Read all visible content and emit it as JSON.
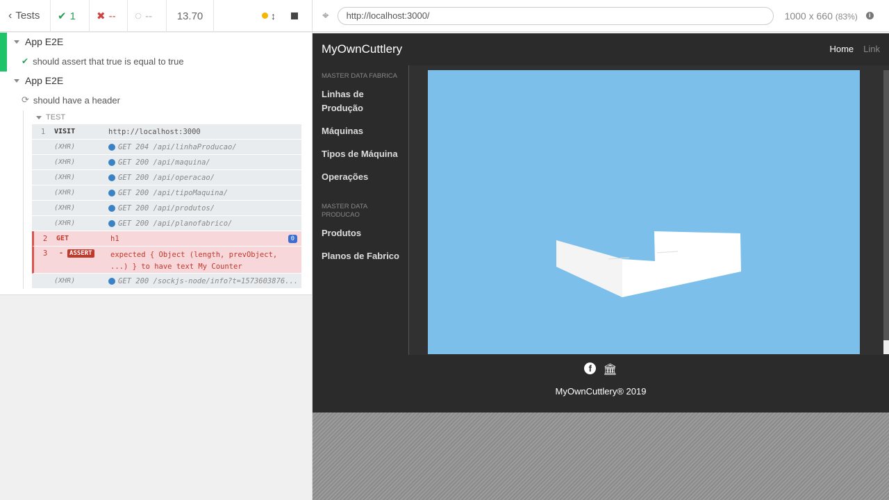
{
  "reporter": {
    "back_label": "Tests",
    "passed": "1",
    "failed": "--",
    "pending": "--",
    "duration": "13.70",
    "suites": [
      {
        "title": "App E2E",
        "test": "should assert that true is equal to true"
      },
      {
        "title": "App E2E",
        "test": "should have a header",
        "test_label": "TEST",
        "commands": [
          {
            "num": "1",
            "name": "VISIT",
            "msg": "http://localhost:3000"
          },
          {
            "num": "",
            "name": "(XHR)",
            "msg": "GET 204 /api/linhaProducao/"
          },
          {
            "num": "",
            "name": "(XHR)",
            "msg": "GET 200 /api/maquina/"
          },
          {
            "num": "",
            "name": "(XHR)",
            "msg": "GET 200 /api/operacao/"
          },
          {
            "num": "",
            "name": "(XHR)",
            "msg": "GET 200 /api/tipoMaquina/"
          },
          {
            "num": "",
            "name": "(XHR)",
            "msg": "GET 200 /api/produtos/"
          },
          {
            "num": "",
            "name": "(XHR)",
            "msg": "GET 200 /api/planofabrico/"
          },
          {
            "num": "2",
            "name": "GET",
            "msg": "h1",
            "badge": "0"
          },
          {
            "num": "3",
            "name": "ASSERT",
            "msg_line1": "expected { Object (length, prevObject,",
            "msg_line2": "...) } to have text My Counter"
          },
          {
            "num": "",
            "name": "(XHR)",
            "msg": "GET 200 /sockjs-node/info?t=1573603876..."
          }
        ]
      }
    ]
  },
  "preview": {
    "url": "http://localhost:3000/",
    "viewport": "1000 x 660",
    "zoom": "(83%)"
  },
  "app": {
    "brand": "MyOwnCuttlery",
    "nav": [
      "Home",
      "Link"
    ],
    "side_sections": [
      {
        "heading": "MASTER DATA FABRICA",
        "items": [
          "Linhas de Produção",
          "Máquinas",
          "Tipos de Máquina",
          "Operações"
        ]
      },
      {
        "heading": "MASTER DATA PRODUCAO",
        "items": [
          "Produtos",
          "Planos de Fabrico"
        ]
      }
    ],
    "footer": "MyOwnCuttlery® 2019"
  },
  "colors": {
    "pass_green": "#1fc36a",
    "fail_red": "#c0392b",
    "canvas_blue": "#7dbfeb",
    "app_dark": "#2b2b2b"
  }
}
